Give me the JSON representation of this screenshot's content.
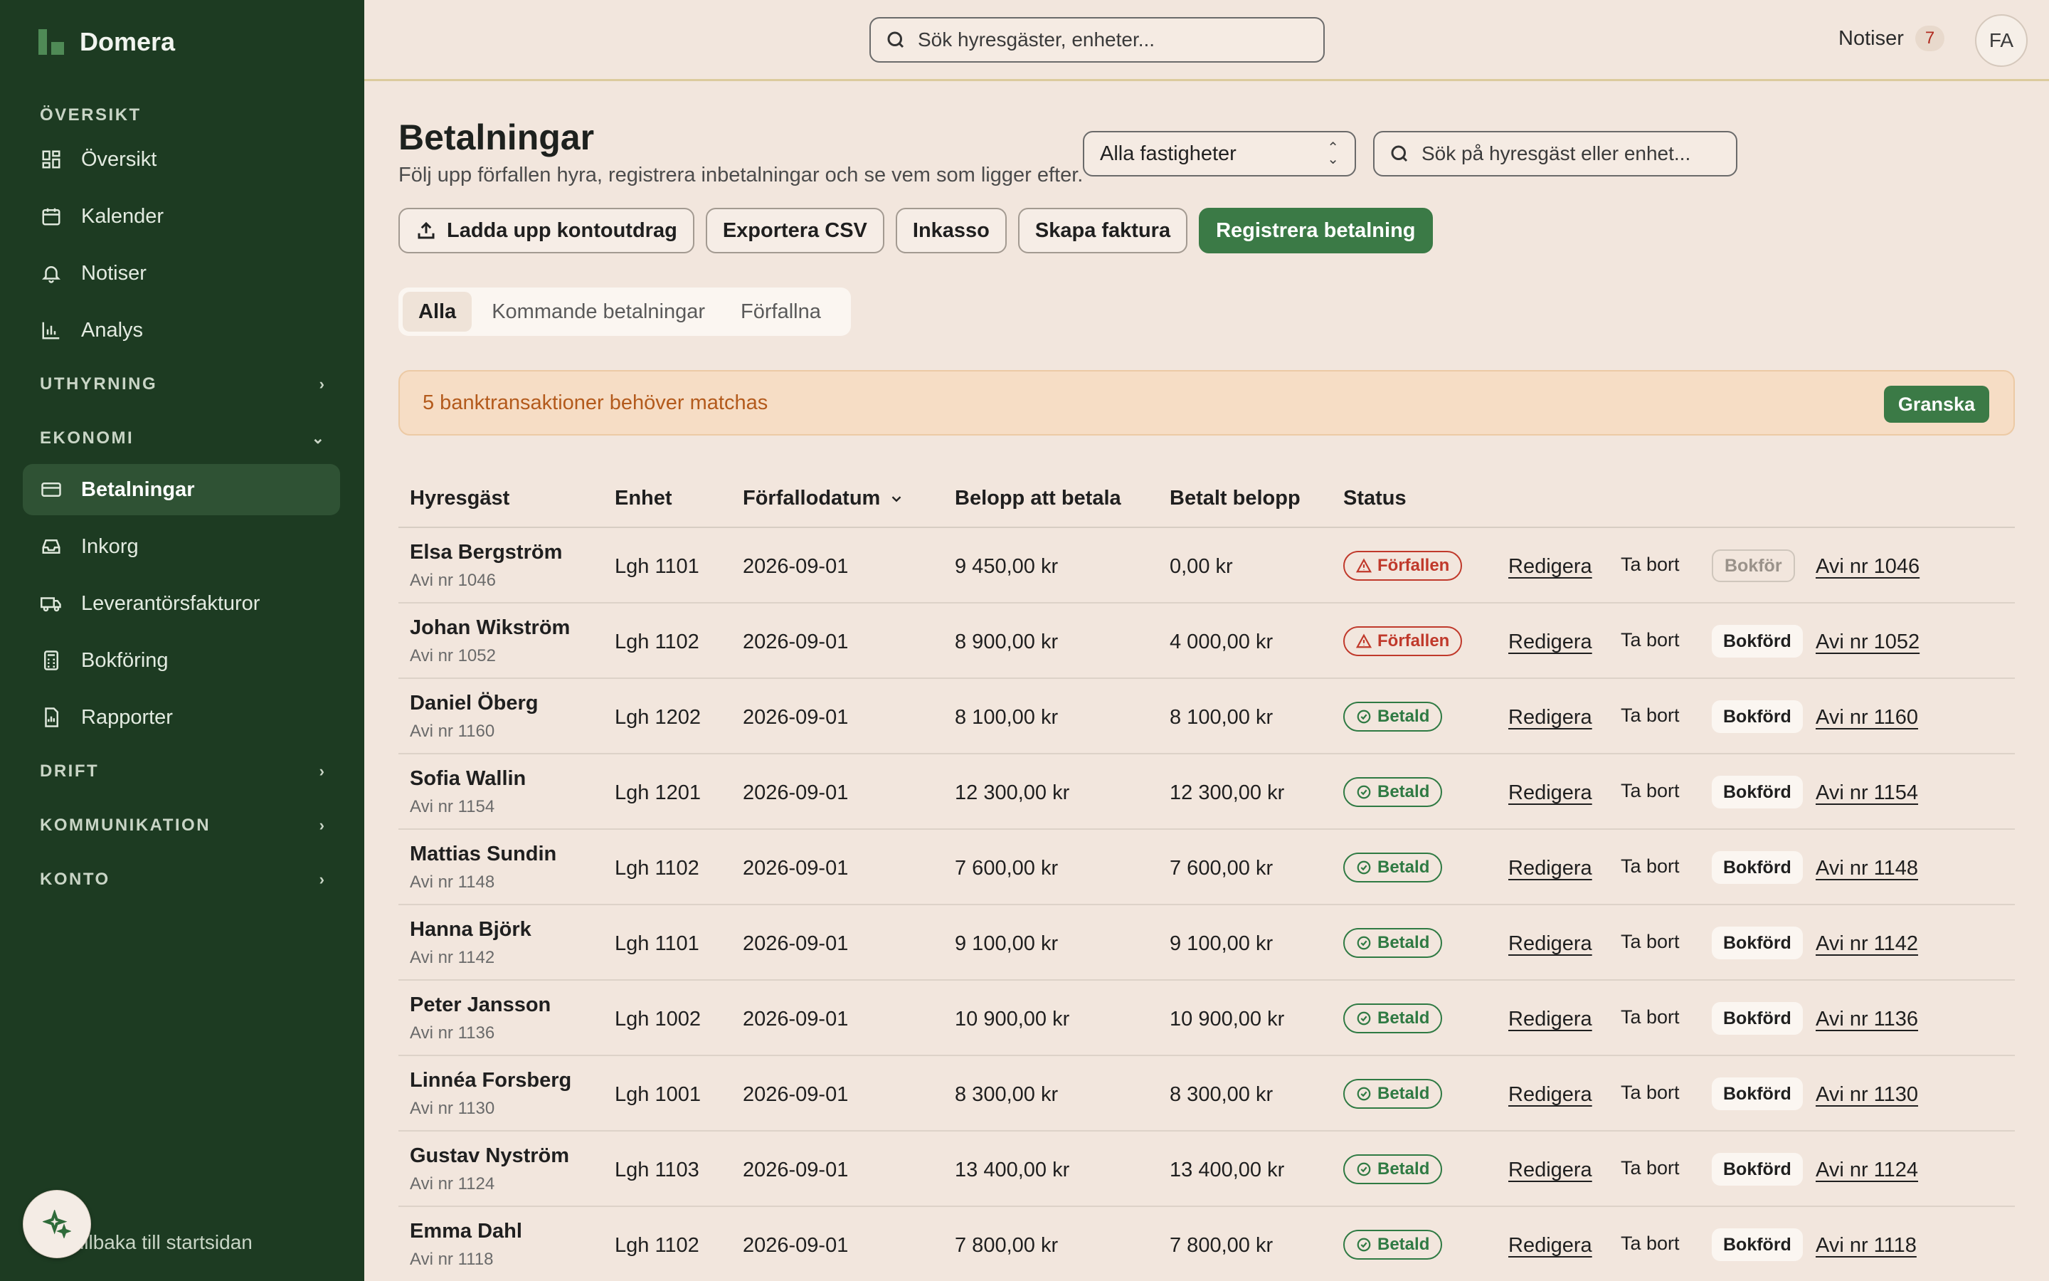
{
  "brand": {
    "name": "Domera"
  },
  "sidebar": {
    "sections": {
      "overview": "ÖVERSIKT",
      "rental": "UTHYRNING",
      "economy": "EKONOMI",
      "operations": "DRIFT",
      "communication": "KOMMUNIKATION",
      "account": "KONTO"
    },
    "items": {
      "overview": "Översikt",
      "calendar": "Kalender",
      "notifications": "Notiser",
      "analysis": "Analys",
      "payments": "Betalningar",
      "inbox": "Inkorg",
      "supplier_invoices": "Leverantörsfakturor",
      "bookkeeping": "Bokföring",
      "reports": "Rapporter"
    },
    "back_link": "Tillbaka till startsidan"
  },
  "topbar": {
    "search_placeholder": "Sök hyresgäster, enheter...",
    "notifications_label": "Notiser",
    "notifications_count": "7",
    "avatar_initials": "FA"
  },
  "header": {
    "title": "Betalningar",
    "subtitle": "Följ upp förfallen hyra, registrera inbetalningar och se vem som ligger efter.",
    "property_select": "Alla fastigheter",
    "tenant_search_placeholder": "Sök på hyresgäst eller enhet..."
  },
  "actions": {
    "upload": "Ladda upp kontoutdrag",
    "export": "Exportera CSV",
    "collection": "Inkasso",
    "create_invoice": "Skapa faktura",
    "register_payment": "Registrera betalning"
  },
  "tabs": [
    "Alla",
    "Kommande betalningar",
    "Förfallna"
  ],
  "alert": {
    "text": "5 banktransaktioner behöver matchas",
    "button": "Granska"
  },
  "table": {
    "headers": {
      "tenant": "Hyresgäst",
      "unit": "Enhet",
      "due_date": "Förfallodatum",
      "amount_due": "Belopp att betala",
      "paid": "Betalt belopp",
      "status": "Status"
    },
    "edit_label": "Redigera",
    "delete_label": "Ta bort",
    "rows": [
      {
        "name": "Elsa Bergström",
        "avi": "Avi nr 1046",
        "unit": "Lgh 1101",
        "due": "2026-09-01",
        "amount": "9 450,00 kr",
        "paid": "0,00 kr",
        "status": "Förfallen",
        "book": "Bokför",
        "link": "Avi nr 1046"
      },
      {
        "name": "Johan Wikström",
        "avi": "Avi nr 1052",
        "unit": "Lgh 1102",
        "due": "2026-09-01",
        "amount": "8 900,00 kr",
        "paid": "4 000,00 kr",
        "status": "Förfallen",
        "book": "Bokförd",
        "link": "Avi nr 1052"
      },
      {
        "name": "Daniel Öberg",
        "avi": "Avi nr 1160",
        "unit": "Lgh 1202",
        "due": "2026-09-01",
        "amount": "8 100,00 kr",
        "paid": "8 100,00 kr",
        "status": "Betald",
        "book": "Bokförd",
        "link": "Avi nr 1160"
      },
      {
        "name": "Sofia Wallin",
        "avi": "Avi nr 1154",
        "unit": "Lgh 1201",
        "due": "2026-09-01",
        "amount": "12 300,00 kr",
        "paid": "12 300,00 kr",
        "status": "Betald",
        "book": "Bokförd",
        "link": "Avi nr 1154"
      },
      {
        "name": "Mattias Sundin",
        "avi": "Avi nr 1148",
        "unit": "Lgh 1102",
        "due": "2026-09-01",
        "amount": "7 600,00 kr",
        "paid": "7 600,00 kr",
        "status": "Betald",
        "book": "Bokförd",
        "link": "Avi nr 1148"
      },
      {
        "name": "Hanna Björk",
        "avi": "Avi nr 1142",
        "unit": "Lgh 1101",
        "due": "2026-09-01",
        "amount": "9 100,00 kr",
        "paid": "9 100,00 kr",
        "status": "Betald",
        "book": "Bokförd",
        "link": "Avi nr 1142"
      },
      {
        "name": "Peter Jansson",
        "avi": "Avi nr 1136",
        "unit": "Lgh 1002",
        "due": "2026-09-01",
        "amount": "10 900,00 kr",
        "paid": "10 900,00 kr",
        "status": "Betald",
        "book": "Bokförd",
        "link": "Avi nr 1136"
      },
      {
        "name": "Linnéa Forsberg",
        "avi": "Avi nr 1130",
        "unit": "Lgh 1001",
        "due": "2026-09-01",
        "amount": "8 300,00 kr",
        "paid": "8 300,00 kr",
        "status": "Betald",
        "book": "Bokförd",
        "link": "Avi nr 1130"
      },
      {
        "name": "Gustav Nyström",
        "avi": "Avi nr 1124",
        "unit": "Lgh 1103",
        "due": "2026-09-01",
        "amount": "13 400,00 kr",
        "paid": "13 400,00 kr",
        "status": "Betald",
        "book": "Bokförd",
        "link": "Avi nr 1124"
      },
      {
        "name": "Emma Dahl",
        "avi": "Avi nr 1118",
        "unit": "Lgh 1102",
        "due": "2026-09-01",
        "amount": "7 800,00 kr",
        "paid": "7 800,00 kr",
        "status": "Betald",
        "book": "Bokförd",
        "link": "Avi nr 1118"
      }
    ]
  },
  "colors": {
    "sidebar": "#1d3b22",
    "accent": "#3b7a46",
    "overdue": "#c0392b",
    "paid": "#2f7a43",
    "background": "#f2e6dd"
  }
}
